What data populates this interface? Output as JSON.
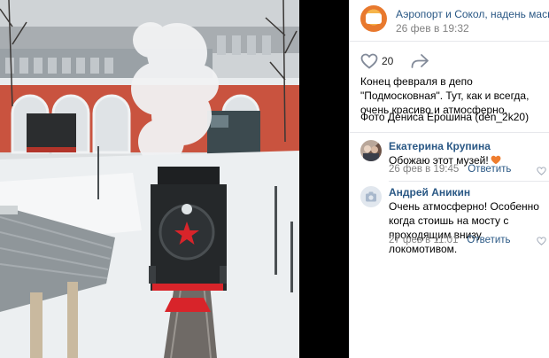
{
  "post": {
    "group_name": "Аэропорт и Сокол, надень маску",
    "date": "26 фев в 19:32",
    "likes": "20",
    "text": "Конец февраля в депо \"Подмосковная\". Тут, как и всегда, очень красиво и атмосферно.",
    "credit": "Фото Дениса Ерошина (den_2k20)"
  },
  "comments": [
    {
      "author": "Екатерина Крупина",
      "text": "Обожаю этот музей!",
      "date": "26 фев в 19:45",
      "reply": "Ответить"
    },
    {
      "author": "Андрей Аникин",
      "text": "Очень атмосферно! Особенно когда стоишь на мосту с проходящим внизу локомотивом.",
      "date": "27 фев в 11:01",
      "reply": "Ответить"
    }
  ],
  "colors": {
    "link": "#2a5885",
    "meta": "#828282",
    "heart": "#e64646"
  },
  "icons": [
    "heart-icon",
    "share-icon",
    "camera-icon",
    "red-star-icon"
  ]
}
